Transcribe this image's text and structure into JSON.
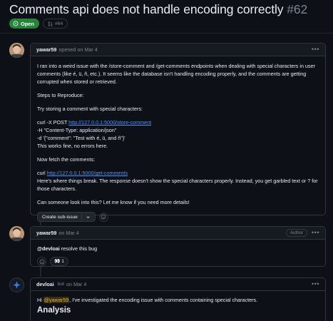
{
  "issue": {
    "title": "Comments api does not handle encoding correctly",
    "number": "#62",
    "state": "Open",
    "linked_pr": "#64"
  },
  "comments": [
    {
      "author": "yawar59",
      "meta": "opened on Mar 4",
      "p1": "I ran into a weird issue with the /store-comment and /get-comments endpoints when dealing with special characters in user comments (like é, ü, ñ, etc.). It seems like the database isn't handling encoding properly, and the comments are getting corrupted when stored or retrieved.",
      "p2": "Steps to Reproduce:",
      "p3": "Try storing a comment with special characters:",
      "curl1_prefix": "curl -X POST ",
      "curl1_url": "http://127.0.0.1:5000/store-comment",
      "curl1_h": "-H \"Content-Type: application/json\"",
      "curl1_d": "-d '{\"comment\": \"Test with é, ü, and ñ\"}'",
      "curl1_note": "This works fine, no errors here.",
      "p4": "Now fetch the comments:",
      "curl2_prefix": "curl ",
      "curl2_url": "http://127.0.0.1:5000/get-comments",
      "p5": "Here's where things break. The response doesn't show the special characters properly. Instead, you get garbled text or ? for those characters.",
      "p6": "Can someone look into this? Let me know if you need more details!",
      "sub_issue_label": "Create sub-issue"
    },
    {
      "author": "yawar59",
      "meta": "on Mar 4",
      "tag": "Author",
      "mention": "@devloai",
      "text": " resolve this bug",
      "reaction_emoji": "👀",
      "reaction_count": "1"
    },
    {
      "author": "devloai",
      "bot_tag": "bot",
      "meta": "on Mar 4",
      "greeting": "Hi ",
      "mention": "@yawar59",
      "text": ", I've investigated the encoding issue with comments containing special characters.",
      "heading": "Analysis"
    }
  ],
  "icons": {
    "open": "issue-opened-icon",
    "pr": "git-pull-request-icon",
    "kebab": "kebab-horizontal-icon",
    "smiley": "smiley-icon",
    "chevron": "chevron-down-icon",
    "bot": "devloai-logo-icon"
  },
  "colors": {
    "background": "#0d1117",
    "open_green": "#238636",
    "link": "#4493f8",
    "border": "#30363d",
    "muted": "#7d8590"
  }
}
